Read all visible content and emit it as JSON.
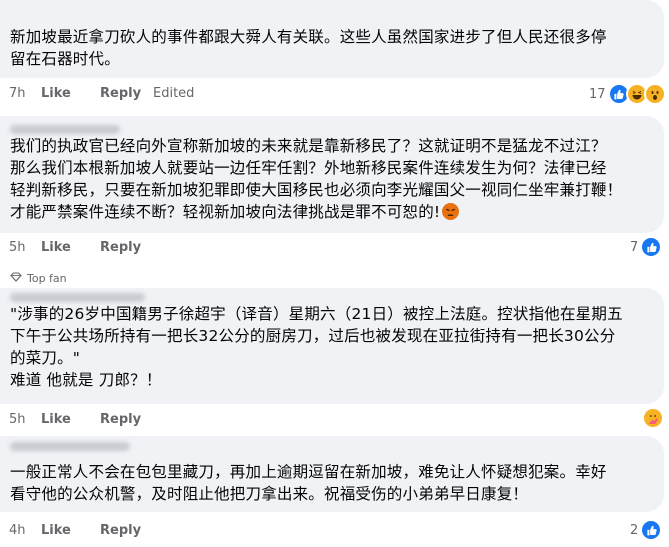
{
  "comments": [
    {
      "text": "新加坡最近拿刀砍人的事件都跟大舜人有关联。这些人虽然国家进步了但人民还很多停\n留在石器时代。",
      "time": "7h",
      "like": "Like",
      "reply": "Reply",
      "edited": "Edited",
      "reaction_count": "17",
      "reactions": [
        "like-icon",
        "laugh-icon",
        "wow-icon"
      ]
    },
    {
      "text": "我们的执政官已经向外宣称新加坡的未来就是靠新移民了？这就证明不是猛龙不过江？\n那么我们本根新加坡人就要站一边任牢任割？外地新移民案件连续发生为何？法律已经\n轻判新移民，只要在新加坡犯罪即使大国移民也必须向李光耀国父一视同仁坐牢兼打鞭！\n才能严禁案件连续不断？轻视新加坡向法律挑战是罪不可恕的!",
      "time": "5h",
      "like": "Like",
      "reply": "Reply",
      "reaction_count": "7",
      "reactions": [
        "like-icon"
      ]
    },
    {
      "badge": "Top fan",
      "text": "\"涉事的26岁中国籍男子徐超宇（译音）星期六（21日）被控上法庭。控状指他在星期五\n下午于公共场所持有一把长32公分的厨房刀，过后也被发现在亚拉街持有一把长30公分\n的菜刀。\"\n难道 他就是 刀郎？！",
      "time": "5h",
      "like": "Like",
      "reply": "Reply",
      "reaction_count": "",
      "reactions": [
        "care-icon"
      ]
    },
    {
      "text": "一般正常人不会在包包里藏刀，再加上逾期逗留在新加坡，难免让人怀疑想犯案。幸好\n看守他的公众机警，及时阻止他把刀拿出来。祝福受伤的小弟弟早日康复！",
      "time": "4h",
      "like": "Like",
      "reply": "Reply",
      "reaction_count": "2",
      "reactions": [
        "like-icon"
      ]
    }
  ]
}
